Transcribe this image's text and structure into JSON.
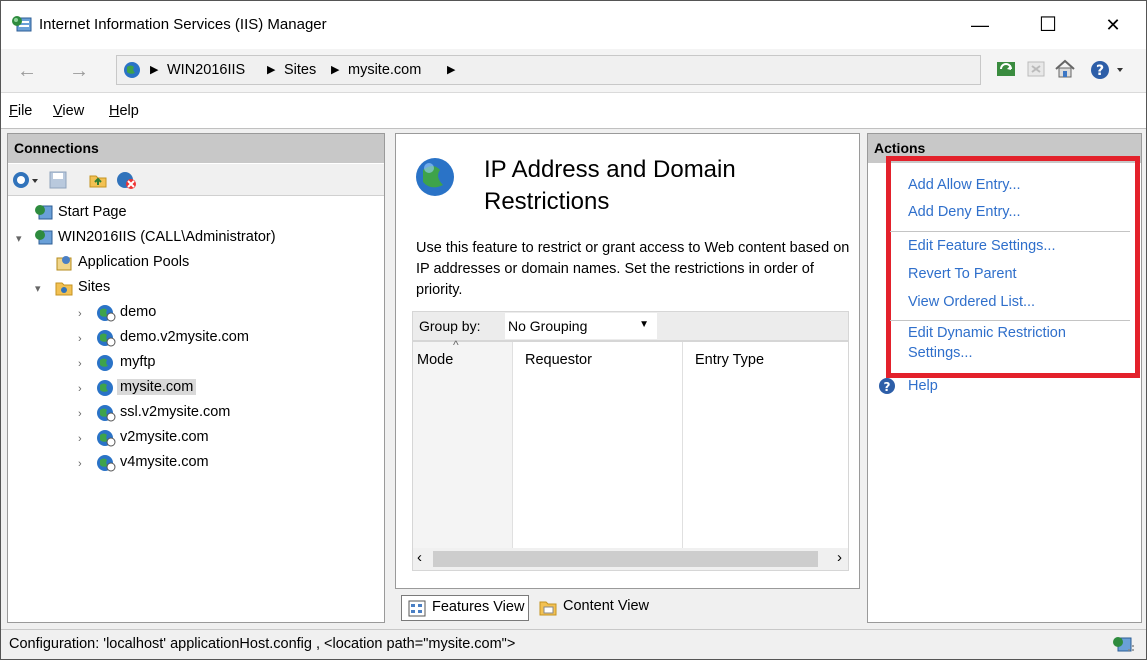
{
  "window": {
    "title": "Internet Information Services (IIS) Manager",
    "minimize": "—",
    "maximize": "☐",
    "close": "✕"
  },
  "address": {
    "crumbs": [
      "WIN2016IIS",
      "Sites",
      "mysite.com"
    ],
    "sep": "▶"
  },
  "menu": {
    "file": "File",
    "view": "View",
    "help": "Help"
  },
  "connections": {
    "header": "Connections",
    "tree": [
      {
        "label": "Start Page",
        "icon": "start-page-icon"
      },
      {
        "label": "WIN2016IIS (CALL\\Administrator)",
        "icon": "server-icon"
      },
      {
        "label": "Application Pools",
        "icon": "app-pool-icon"
      },
      {
        "label": "Sites",
        "icon": "folder-icon"
      },
      {
        "label": "demo",
        "icon": "site-icon"
      },
      {
        "label": "demo.v2mysite.com",
        "icon": "site-icon"
      },
      {
        "label": "myftp",
        "icon": "site-icon"
      },
      {
        "label": "mysite.com",
        "icon": "site-icon"
      },
      {
        "label": "ssl.v2mysite.com",
        "icon": "site-icon"
      },
      {
        "label": "v2mysite.com",
        "icon": "site-icon"
      },
      {
        "label": "v4mysite.com",
        "icon": "site-icon"
      }
    ]
  },
  "feature": {
    "title_line1": "IP Address and Domain",
    "title_line2": "Restrictions",
    "description": "Use this feature to restrict or grant access to Web content based on IP addresses or domain names. Set the restrictions in order of priority.",
    "group_by_label": "Group by:",
    "group_by_value": "No Grouping",
    "columns": [
      "Mode",
      "Requestor",
      "Entry Type"
    ]
  },
  "view_tabs": {
    "features": "Features View",
    "content": "Content View"
  },
  "actions": {
    "header": "Actions",
    "items": [
      "Add Allow Entry...",
      "Add Deny Entry...",
      "Edit Feature Settings...",
      "Revert To Parent",
      "View Ordered List...",
      "Edit Dynamic Restriction",
      "Settings..."
    ],
    "help": "Help"
  },
  "status": {
    "text": "Configuration: 'localhost' applicationHost.config , <location path=\"mysite.com\">"
  },
  "colors": {
    "link": "#2f6fcb",
    "highlight_box": "#e3212b",
    "pane_header": "#c8c8c8"
  }
}
